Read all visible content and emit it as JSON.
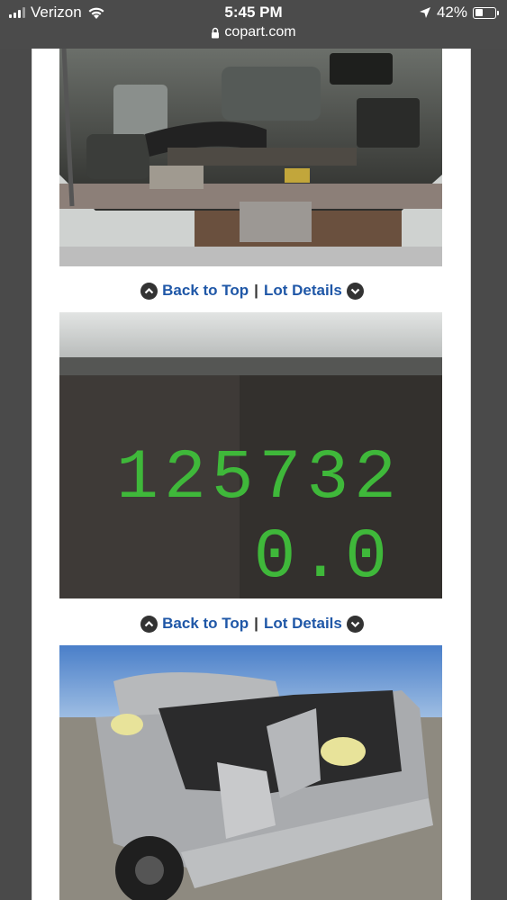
{
  "status_bar": {
    "carrier": "Verizon",
    "time": "5:45 PM",
    "url": "copart.com",
    "battery_percent": "42%",
    "battery_level": 0.42
  },
  "nav": {
    "back_to_top": "Back to Top",
    "separator": "|",
    "lot_details": "Lot Details"
  },
  "photos": [
    {
      "subject": "engine bay"
    },
    {
      "subject": "odometer",
      "reading_main": "125732",
      "reading_trip": "0.0"
    },
    {
      "subject": "damaged truck rear"
    }
  ]
}
